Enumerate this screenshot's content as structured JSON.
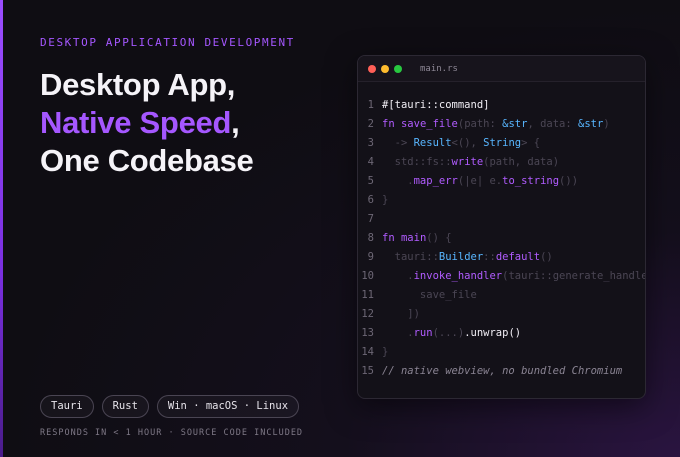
{
  "hero": {
    "eyebrow": "DESKTOP APPLICATION DEVELOPMENT",
    "headline_line1": "Desktop App,",
    "headline_accent": "Native Speed",
    "headline_comma": ",",
    "headline_line3": "One Codebase"
  },
  "tags": [
    "Tauri",
    "Rust",
    "Win · macOS · Linux"
  ],
  "footnote": "RESPONDS IN < 1 HOUR · SOURCE CODE INCLUDED",
  "editor": {
    "filename": "main.rs",
    "line_numbers": [
      "1",
      "2",
      "3",
      "4",
      "5",
      "6",
      "7",
      "8",
      "9",
      "10",
      "11",
      "12",
      "13",
      "14",
      "15"
    ],
    "tokens": {
      "l1": "#[tauri::command]",
      "l2_fn": "fn",
      "l2_name": "save_file",
      "l2_p1": "(path: ",
      "l2_t1": "&str",
      "l2_p2": ", data: ",
      "l2_t2": "&str",
      "l2_p3": ")",
      "l3_arrow": "  -> ",
      "l3_t1": "Result",
      "l3_p1": "<(), ",
      "l3_t2": "String",
      "l3_p2": "> {",
      "l4_p1": "  std::fs::",
      "l4_fn": "write",
      "l4_p2": "(path, data)",
      "l5_p0": "    .",
      "l5_fn": "map_err",
      "l5_p1": "(|e| e.",
      "l5_fn2": "to_string",
      "l5_p2": "())",
      "l6": "}",
      "l8_fn": "fn",
      "l8_name": "main",
      "l8_p": "() {",
      "l9_p1": "  tauri::",
      "l9_t": "Builder",
      "l9_p2": "::",
      "l9_fn": "default",
      "l9_p3": "()",
      "l10_p0": "    .",
      "l10_fn": "invoke_handler",
      "l10_p1": "(tauri::generate_handler![",
      "l11": "      save_file",
      "l12": "    ])",
      "l13_p0": "    .",
      "l13_fn": "run",
      "l13_p1": "(...)",
      "l13_p2": ".unwrap()",
      "l14": "}",
      "l15": "// native webview, no bundled Chromium"
    }
  },
  "colors": {
    "accent": "#a557ff",
    "type": "#58b6ff",
    "background": "#0f0d13"
  }
}
